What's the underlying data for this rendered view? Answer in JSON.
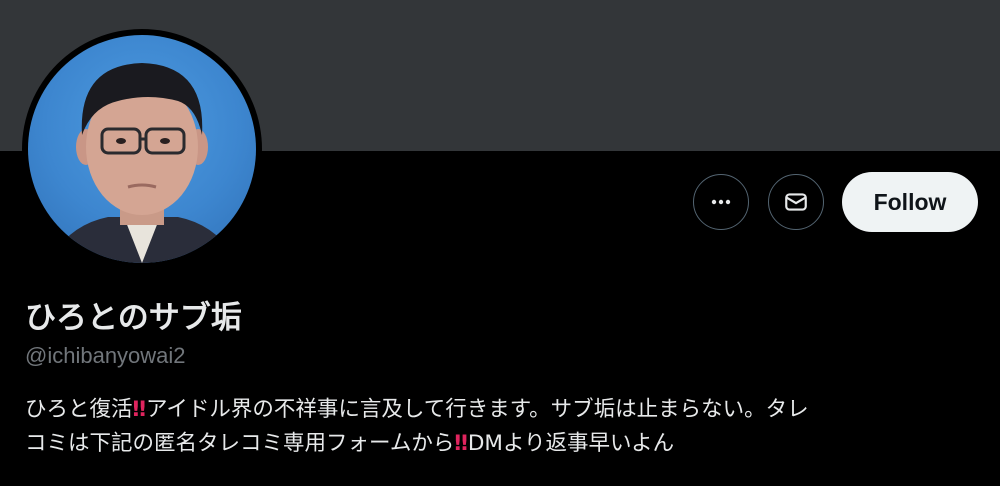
{
  "profile": {
    "display_name": "ひろとのサブ垢",
    "handle": "@ichibanyowai2",
    "bio_line1_a": "ひろと復活",
    "bio_line1_b": "アイドル界の不祥事に言及して行きます。サブ垢は止まらない。タレ",
    "bio_line2_a": "コミは下記の匿名タレコミ専用フォームから",
    "bio_line2_b": "DMより返事早いよん",
    "emoji_double_exclamation": "‼"
  },
  "actions": {
    "follow_label": "Follow",
    "more_icon": "more-horizontal-icon",
    "message_icon": "envelope-icon"
  },
  "colors": {
    "banner": "#333639",
    "background": "#000000",
    "follow_bg": "#eff3f4",
    "handle_text": "#71767b",
    "emoji_red": "#e0245e"
  }
}
